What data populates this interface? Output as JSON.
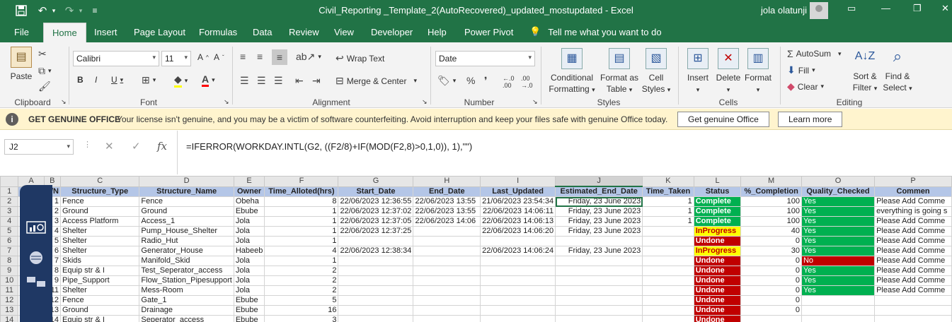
{
  "window": {
    "title": "Civil_Reporting _Template_2(AutoRecovered)_updated_mostupdated  -  Excel",
    "user": "jola olatunji"
  },
  "menu": {
    "tabs": [
      "File",
      "Home",
      "Insert",
      "Page Layout",
      "Formulas",
      "Data",
      "Review",
      "View",
      "Developer",
      "Help",
      "Power Pivot"
    ],
    "tell_me": "Tell me what you want to do"
  },
  "ribbon": {
    "clipboard": {
      "paste": "Paste",
      "label": "Clipboard"
    },
    "font": {
      "name": "Calibri",
      "size": "11",
      "label": "Font"
    },
    "alignment": {
      "wrap": "Wrap Text",
      "merge": "Merge & Center",
      "label": "Alignment"
    },
    "number": {
      "format": "Date",
      "label": "Number"
    },
    "styles": {
      "cond_fmt": "Conditional Formatting",
      "fmt_table": "Format as Table",
      "cell_styles": "Cell Styles",
      "label": "Styles"
    },
    "cells": {
      "insert": "Insert",
      "delete": "Delete",
      "format": "Format",
      "label": "Cells"
    },
    "editing": {
      "autosum": "AutoSum",
      "fill": "Fill",
      "clear": "Clear",
      "sort": "Sort & Filter",
      "find": "Find & Select",
      "label": "Editing"
    }
  },
  "notice": {
    "heading": "GET GENUINE OFFICE",
    "message": "Your license isn't genuine, and you may be a victim of software counterfeiting. Avoid interruption and keep your files safe with genuine Office today.",
    "btn_genuine": "Get genuine Office",
    "btn_learn": "Learn more"
  },
  "formula_bar": {
    "name_box": "J2",
    "formula": "=IFERROR(WORKDAY.INTL(G2, ((F2/8)+IF(MOD(F2,8)>0,1,0)), 1),\"\")"
  },
  "sheet": {
    "columns": [
      "A",
      "B",
      "C",
      "D",
      "E",
      "F",
      "G",
      "H",
      "I",
      "J",
      "K",
      "L",
      "M",
      "O",
      "P"
    ],
    "headers": [
      "",
      "S/N",
      "Structure_Type",
      "Structure_Name",
      "Owner",
      "Time_Alloted(hrs)",
      "Start_Date",
      "End_Date",
      "Last_Updated",
      "Estimated_End_Date",
      "Time_Taken",
      "Status",
      "%_Completion",
      "Quality_Checked",
      "Commen"
    ],
    "rows": [
      [
        "1",
        "Fence",
        "Fence",
        "Obeha",
        "8",
        "22/06/2023 12:36:55",
        "22/06/2023 13:55",
        "21/06/2023 23:54:34",
        "Friday, 23 June 2023",
        "1",
        "Complete",
        "100",
        "Yes",
        "Please Add Comme"
      ],
      [
        "2",
        "Ground",
        "Ground",
        "Ebube",
        "1",
        "22/06/2023 12:37:02",
        "22/06/2023 13:55",
        "22/06/2023 14:06:11",
        "Friday, 23 June 2023",
        "1",
        "Complete",
        "100",
        "Yes",
        "everything is going s"
      ],
      [
        "3",
        "Access Platform",
        "Access_1",
        "Jola",
        "1",
        "22/06/2023 12:37:05",
        "22/06/2023 14:06",
        "22/06/2023 14:06:13",
        "Friday, 23 June 2023",
        "1",
        "Complete",
        "100",
        "Yes",
        "Please Add Comme"
      ],
      [
        "4",
        "Shelter",
        "Pump_House_Shelter",
        "Jola",
        "1",
        "22/06/2023 12:37:25",
        "",
        "22/06/2023 14:06:20",
        "Friday, 23 June 2023",
        "",
        "InProgress",
        "40",
        "Yes",
        "Please Add Comme"
      ],
      [
        "5",
        "Shelter",
        "Radio_Hut",
        "Jola",
        "1",
        "",
        "",
        "",
        "",
        "",
        "Undone",
        "0",
        "Yes",
        "Please Add Comme"
      ],
      [
        "6",
        "Shelter",
        "Generator_House",
        "Habeeb",
        "4",
        "22/06/2023 12:38:34",
        "",
        "22/06/2023 14:06:24",
        "Friday, 23 June 2023",
        "",
        "InProgress",
        "30",
        "Yes",
        "Please Add Comme"
      ],
      [
        "7",
        "Skids",
        "Manifold_Skid",
        "Jola",
        "1",
        "",
        "",
        "",
        "",
        "",
        "Undone",
        "0",
        "No",
        "Please Add Comme"
      ],
      [
        "8",
        "Equip str & I",
        "Test_Seperator_access",
        "Jola",
        "2",
        "",
        "",
        "",
        "",
        "",
        "Undone",
        "0",
        "Yes",
        "Please Add Comme"
      ],
      [
        "9",
        "Pipe_Support",
        "Flow_Station_Pipesupport",
        "Jola",
        "2",
        "",
        "",
        "",
        "",
        "",
        "Undone",
        "0",
        "Yes",
        "Please Add Comme"
      ],
      [
        "11",
        "Shelter",
        "Mess-Room",
        "Jola",
        "2",
        "",
        "",
        "",
        "",
        "",
        "Undone",
        "0",
        "Yes",
        "Please Add Comme"
      ],
      [
        "12",
        "Fence",
        "Gate_1",
        "Ebube",
        "5",
        "",
        "",
        "",
        "",
        "",
        "Undone",
        "0",
        "",
        ""
      ],
      [
        "13",
        "Ground",
        "Drainage",
        "Ebube",
        "16",
        "",
        "",
        "",
        "",
        "",
        "Undone",
        "0",
        "",
        ""
      ],
      [
        "14",
        "Equip str & I",
        "Seperator_access",
        "Ebube",
        "3",
        "",
        "",
        "",
        "",
        "",
        "Undone",
        "",
        "",
        ""
      ]
    ]
  },
  "colors": {
    "excel_green": "#217346",
    "complete": "#00b050",
    "inprogress": "#ffff00",
    "undone": "#c00000",
    "header_fill": "#b4c6e7",
    "sidepanel": "#1f3864"
  }
}
